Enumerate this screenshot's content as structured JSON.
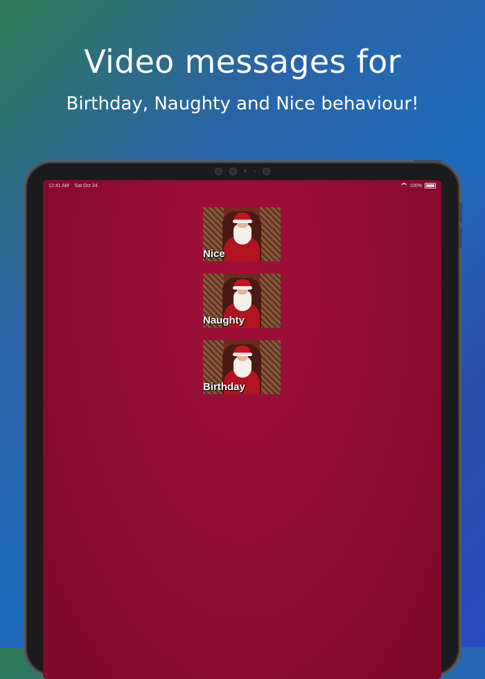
{
  "promo": {
    "headline": "Video messages for",
    "subline": "Birthday, Naughty and Nice behaviour!"
  },
  "status_bar": {
    "time": "12:41 AM",
    "date": "Sat Oct 24",
    "battery": "100%"
  },
  "videos": [
    {
      "label": "Nice"
    },
    {
      "label": "Naughty"
    },
    {
      "label": "Birthday"
    }
  ],
  "colors": {
    "screen_background": "#8e0b32",
    "santa_red": "#b3131e"
  }
}
